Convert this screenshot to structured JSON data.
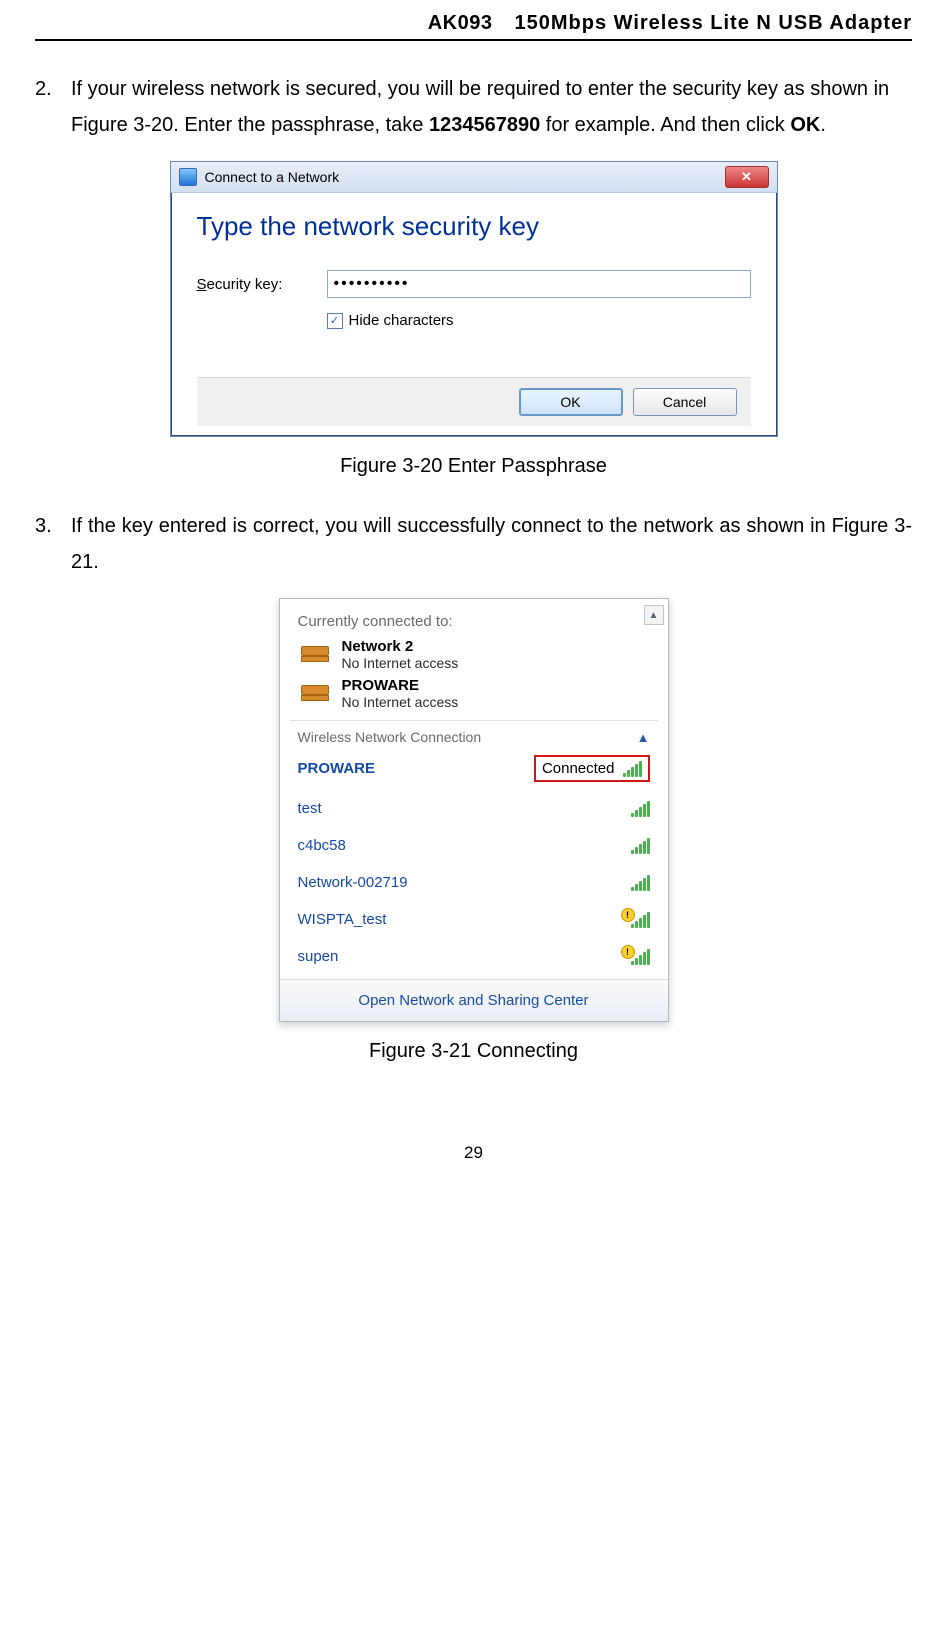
{
  "header": {
    "code": "AK093",
    "title": "150Mbps Wireless Lite N USB Adapter"
  },
  "items": {
    "two": {
      "num": "2.",
      "text_a": "If your wireless network is secured, you will be required to enter the security key as shown in Figure 3-20. Enter the passphrase, take ",
      "pass": "1234567890",
      "text_b": " for example. And then click ",
      "ok": "OK",
      "text_c": "."
    },
    "three": {
      "num": "3.",
      "text_a": "If the key entered is correct, you will successfully connect to the network as shown in Figure 3-21."
    }
  },
  "dialog": {
    "title": "Connect to a Network",
    "heading": "Type the network security key",
    "label_a": "S",
    "label_b": "ecurity key:",
    "password_mask": "••••••••••",
    "checkbox_a": "H",
    "checkbox_b": "ide characters",
    "ok": "OK",
    "cancel": "Cancel"
  },
  "captions": {
    "f20": "Figure 3-20 Enter Passphrase",
    "f21": "Figure 3-21 Connecting"
  },
  "flyout": {
    "currently": "Currently connected to:",
    "conn": [
      {
        "name": "Network 2",
        "sub": "No Internet access"
      },
      {
        "name": "PROWARE",
        "sub": "No Internet access"
      }
    ],
    "wnc": "Wireless Network Connection",
    "connected_text": "Connected",
    "nets": [
      {
        "name": "PROWARE",
        "connected": true,
        "warn": false
      },
      {
        "name": "test",
        "connected": false,
        "warn": false
      },
      {
        "name": "c4bc58",
        "connected": false,
        "warn": false
      },
      {
        "name": "Network-002719",
        "connected": false,
        "warn": false
      },
      {
        "name": "WISPTA_test",
        "connected": false,
        "warn": true
      },
      {
        "name": "supen",
        "connected": false,
        "warn": true
      }
    ],
    "footer": "Open Network and Sharing Center"
  },
  "page_number": "29"
}
